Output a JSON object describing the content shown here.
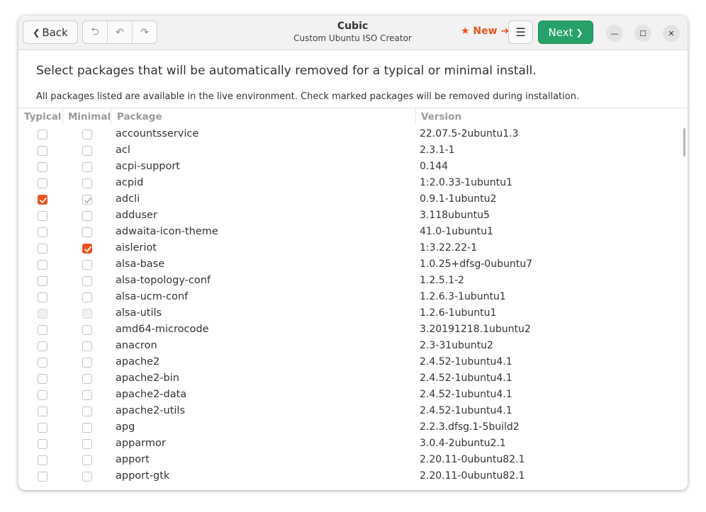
{
  "header": {
    "back_label": "Back",
    "title": "Cubic",
    "subtitle": "Custom Ubuntu ISO Creator",
    "new_label": "★ New ➔",
    "next_label": "Next"
  },
  "main": {
    "heading": "Select packages that will be automatically removed for a typical or minimal install.",
    "subheading": "All packages listed are available in the live environment. Check marked packages will be removed during installation."
  },
  "table": {
    "columns": {
      "typical": "Typical",
      "minimal": "Minimal",
      "package": "Package",
      "version": "Version"
    },
    "rows": [
      {
        "name": "accountsservice",
        "version": "22.07.5-2ubuntu1.3",
        "typical": "unchecked",
        "minimal": "unchecked"
      },
      {
        "name": "acl",
        "version": "2.3.1-1",
        "typical": "unchecked",
        "minimal": "unchecked"
      },
      {
        "name": "acpi-support",
        "version": "0.144",
        "typical": "unchecked",
        "minimal": "unchecked"
      },
      {
        "name": "acpid",
        "version": "1:2.0.33-1ubuntu1",
        "typical": "unchecked",
        "minimal": "unchecked"
      },
      {
        "name": "adcli",
        "version": "0.9.1-1ubuntu2",
        "typical": "checked",
        "minimal": "dim-checked"
      },
      {
        "name": "adduser",
        "version": "3.118ubuntu5",
        "typical": "unchecked",
        "minimal": "unchecked"
      },
      {
        "name": "adwaita-icon-theme",
        "version": "41.0-1ubuntu1",
        "typical": "unchecked",
        "minimal": "unchecked"
      },
      {
        "name": "aisleriot",
        "version": "1:3.22.22-1",
        "typical": "unchecked",
        "minimal": "checked"
      },
      {
        "name": "alsa-base",
        "version": "1.0.25+dfsg-0ubuntu7",
        "typical": "unchecked",
        "minimal": "unchecked"
      },
      {
        "name": "alsa-topology-conf",
        "version": "1.2.5.1-2",
        "typical": "unchecked",
        "minimal": "unchecked"
      },
      {
        "name": "alsa-ucm-conf",
        "version": "1.2.6.3-1ubuntu1",
        "typical": "unchecked",
        "minimal": "unchecked"
      },
      {
        "name": "alsa-utils",
        "version": "1.2.6-1ubuntu1",
        "typical": "disabled",
        "minimal": "disabled"
      },
      {
        "name": "amd64-microcode",
        "version": "3.20191218.1ubuntu2",
        "typical": "unchecked",
        "minimal": "unchecked"
      },
      {
        "name": "anacron",
        "version": "2.3-31ubuntu2",
        "typical": "unchecked",
        "minimal": "unchecked"
      },
      {
        "name": "apache2",
        "version": "2.4.52-1ubuntu4.1",
        "typical": "unchecked",
        "minimal": "unchecked"
      },
      {
        "name": "apache2-bin",
        "version": "2.4.52-1ubuntu4.1",
        "typical": "unchecked",
        "minimal": "unchecked"
      },
      {
        "name": "apache2-data",
        "version": "2.4.52-1ubuntu4.1",
        "typical": "unchecked",
        "minimal": "unchecked"
      },
      {
        "name": "apache2-utils",
        "version": "2.4.52-1ubuntu4.1",
        "typical": "unchecked",
        "minimal": "unchecked"
      },
      {
        "name": "apg",
        "version": "2.2.3.dfsg.1-5build2",
        "typical": "unchecked",
        "minimal": "unchecked"
      },
      {
        "name": "apparmor",
        "version": "3.0.4-2ubuntu2.1",
        "typical": "unchecked",
        "minimal": "unchecked"
      },
      {
        "name": "apport",
        "version": "2.20.11-0ubuntu82.1",
        "typical": "unchecked",
        "minimal": "unchecked"
      },
      {
        "name": "apport-gtk",
        "version": "2.20.11-0ubuntu82.1",
        "typical": "unchecked",
        "minimal": "unchecked"
      }
    ]
  },
  "colors": {
    "accent": "#e95420",
    "next_button": "#26a269"
  },
  "icons": {
    "back": "chevron-left-icon",
    "undo": "undo-icon",
    "revert": "revert-icon",
    "redo": "redo-icon",
    "menu": "hamburger-menu-icon",
    "next": "chevron-right-icon",
    "minimize": "minimize-icon",
    "maximize": "maximize-icon",
    "close": "close-icon"
  }
}
